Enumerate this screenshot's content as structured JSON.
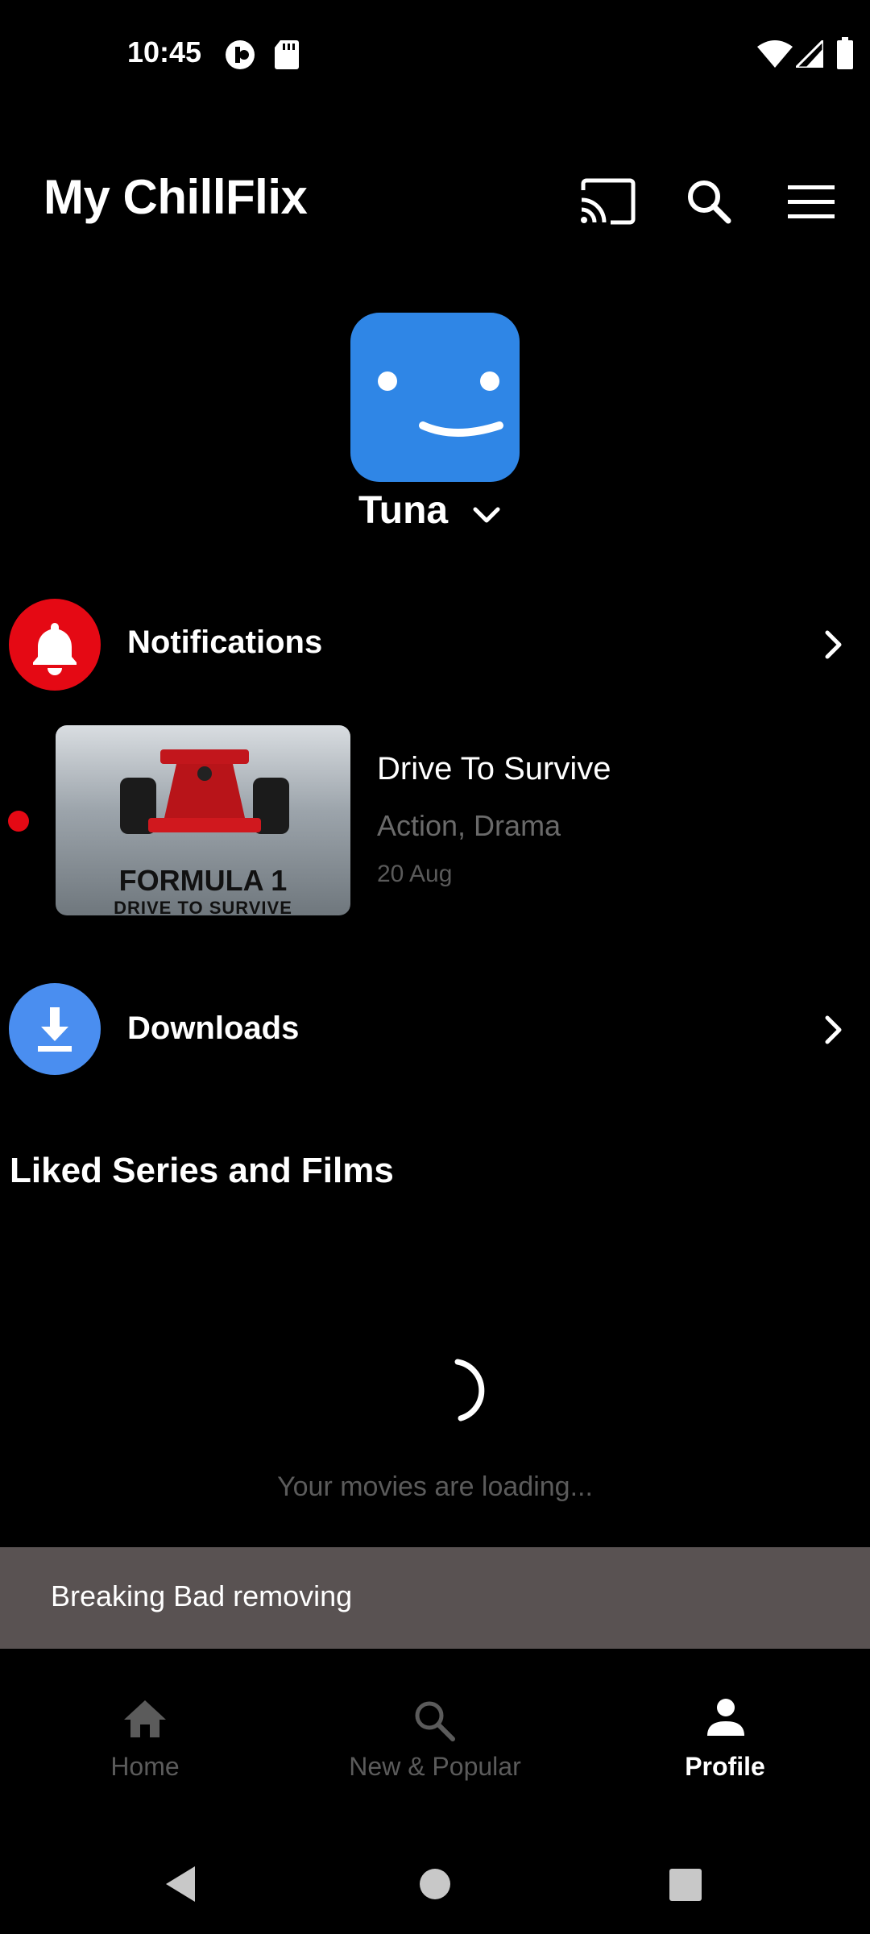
{
  "status_bar": {
    "time": "10:45"
  },
  "app_bar": {
    "title": "My ChillFlix"
  },
  "profile": {
    "name": "Tuna"
  },
  "notifications": {
    "label": "Notifications",
    "item": {
      "title": "Drive To Survive",
      "genre": "Action, Drama",
      "date": "20 Aug",
      "thumb_line1": "FORMULA 1",
      "thumb_line2": "DRIVE TO SURVIVE"
    }
  },
  "downloads": {
    "label": "Downloads"
  },
  "liked": {
    "title": "Liked Series and Films",
    "loading": "Your movies are loading..."
  },
  "snackbar": {
    "text": "Breaking Bad removing"
  },
  "bottom_nav": {
    "items": [
      {
        "label": "Home",
        "icon": "home-icon"
      },
      {
        "label": "New & Popular",
        "icon": "search-icon"
      },
      {
        "label": "Profile",
        "icon": "person-icon"
      }
    ]
  },
  "colors": {
    "background": "#000000",
    "avatar": "#2f86e6",
    "notification_red": "#e50914",
    "download_blue": "#4a8ef0",
    "snackbar": "#595252"
  }
}
